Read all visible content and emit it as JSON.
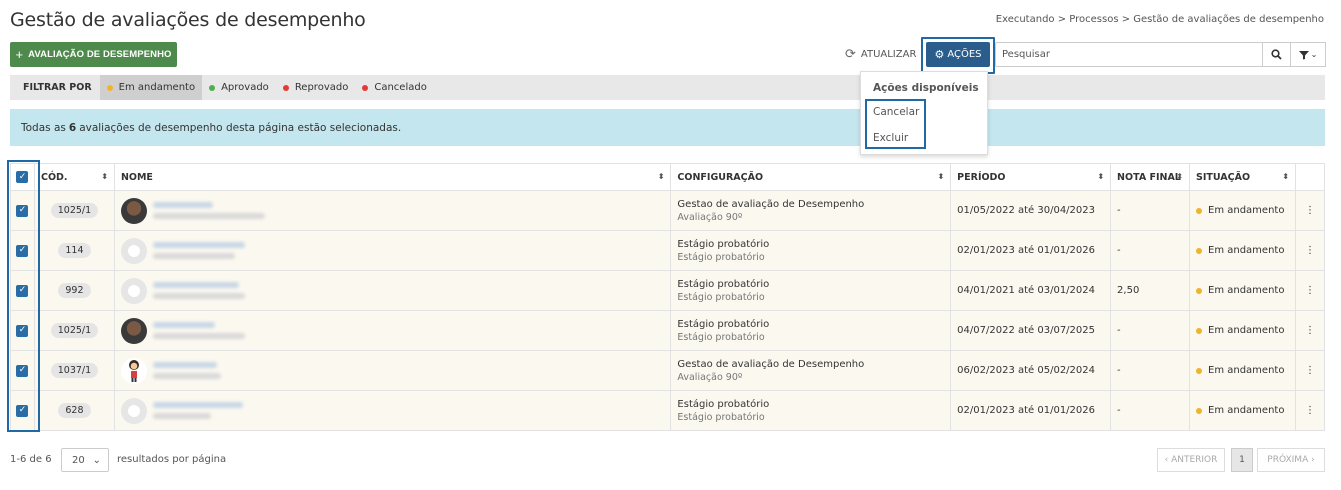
{
  "header": {
    "title": "Gestão de avaliações de desempenho",
    "breadcrumb": "Executando > Processos > Gestão de avaliações de desempenho"
  },
  "toolbar": {
    "add_label": "AVALIAÇÃO DE DESEMPENHO",
    "refresh_label": "ATUALIZAR",
    "actions_label": "AÇÕES",
    "search_placeholder": "Pesquisar"
  },
  "filters": {
    "label": "FILTRAR POR",
    "items": [
      {
        "label": "Em andamento",
        "color": "#f0b429",
        "active": true
      },
      {
        "label": "Aprovado",
        "color": "#4caf50",
        "active": false
      },
      {
        "label": "Reprovado",
        "color": "#e53935",
        "active": false
      },
      {
        "label": "Cancelado",
        "color": "#e53935",
        "active": false
      }
    ]
  },
  "actions_menu": {
    "header": "Ações disponíveis",
    "items": [
      "Cancelar",
      "Excluir"
    ]
  },
  "selection_info": {
    "prefix": "Todas as",
    "count": "6",
    "suffix": "avaliações de desempenho desta página estão selecionadas."
  },
  "table": {
    "columns": [
      "CÓD.",
      "NOME",
      "CONFIGURAÇÃO",
      "PERÍODO",
      "NOTA FINAL",
      "SITUAÇÃO"
    ],
    "rows": [
      {
        "code": "1025/1",
        "avatar": "photo",
        "config": "Gestao de avaliação de Desempenho",
        "config_sub": "Avaliação 90º",
        "period": "01/05/2022 até 30/04/2023",
        "grade": "-",
        "status": "Em andamento"
      },
      {
        "code": "114",
        "avatar": "placeholder",
        "config": "Estágio probatório",
        "config_sub": "Estágio probatório",
        "period": "02/01/2023 até 01/01/2026",
        "grade": "-",
        "status": "Em andamento"
      },
      {
        "code": "992",
        "avatar": "placeholder",
        "config": "Estágio probatório",
        "config_sub": "Estágio probatório",
        "period": "04/01/2021 até 03/01/2024",
        "grade": "2,50",
        "status": "Em andamento"
      },
      {
        "code": "1025/1",
        "avatar": "photo",
        "config": "Estágio probatório",
        "config_sub": "Estágio probatório",
        "period": "04/07/2022 até 03/07/2025",
        "grade": "-",
        "status": "Em andamento"
      },
      {
        "code": "1037/1",
        "avatar": "cartoon",
        "config": "Gestao de avaliação de Desempenho",
        "config_sub": "Avaliação 90º",
        "period": "06/02/2023 até 05/02/2024",
        "grade": "-",
        "status": "Em andamento"
      },
      {
        "code": "628",
        "avatar": "placeholder",
        "config": "Estágio probatório",
        "config_sub": "Estágio probatório",
        "period": "02/01/2023 até 01/01/2026",
        "grade": "-",
        "status": "Em andamento"
      }
    ]
  },
  "footer": {
    "count": "1-6 de 6",
    "per_page": "20",
    "per_page_label": "resultados por página",
    "prev": "‹ ANTERIOR",
    "page": "1",
    "next": "PRÓXIMA ›"
  }
}
